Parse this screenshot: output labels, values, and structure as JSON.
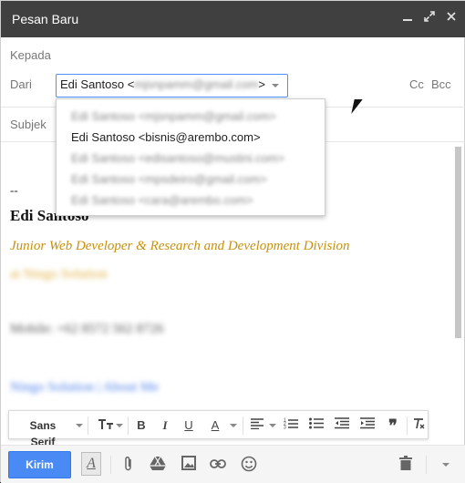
{
  "window": {
    "title": "Pesan Baru",
    "minimize_icon": "minimize-icon",
    "expand_icon": "expand-icon",
    "close_icon": "close-icon"
  },
  "compose": {
    "to_label": "Kepada",
    "from_label": "Dari",
    "from_value_name": "Edi Santoso <",
    "from_value_blurred": "mjsnpamm@gmail.com",
    "from_value_end": ">",
    "cc_label": "Cc",
    "bcc_label": "Bcc",
    "subject_label": "Subjek"
  },
  "from_dropdown": {
    "items": [
      {
        "label": "Edi Santoso <mjsnpamm@gmail.com>",
        "blurred": true
      },
      {
        "label": "Edi Santoso <bisnis@arembo.com>",
        "blurred": false
      },
      {
        "label": "Edi Santoso <edisantoso@mustini.com>",
        "blurred": true
      },
      {
        "label": "Edi Santoso <mpsdeiro@gmail.com>",
        "blurred": true
      },
      {
        "label": "Edi Santoso <cara@arembo.com>",
        "blurred": true
      }
    ]
  },
  "signature": {
    "dash": "--",
    "name": "Edi Santoso",
    "role": "Junior Web Developer & Research and Development Division",
    "company_blurred": "at Ningo Solution",
    "mobile_blurred": "Mobile: +62 8572 562 8726",
    "links_blurred": "Ningo Solution | About Me",
    "colors": {
      "role": "#c9900a",
      "company": "#e0b040",
      "link": "#4a7ee8"
    }
  },
  "format_toolbar": {
    "font_label": "Sans Serif",
    "icons": [
      "font-size-icon",
      "bold-icon",
      "italic-icon",
      "underline-icon",
      "text-color-icon",
      "align-icon",
      "numbered-list-icon",
      "bulleted-list-icon",
      "indent-less-icon",
      "indent-more-icon",
      "quote-icon",
      "remove-formatting-icon"
    ]
  },
  "bottom_toolbar": {
    "send_label": "Kirim",
    "send_color": "#4a8af4",
    "icons": [
      "formatting-icon",
      "attach-icon",
      "drive-icon",
      "photo-icon",
      "link-icon",
      "emoji-icon",
      "trash-icon",
      "more-options-icon"
    ]
  }
}
